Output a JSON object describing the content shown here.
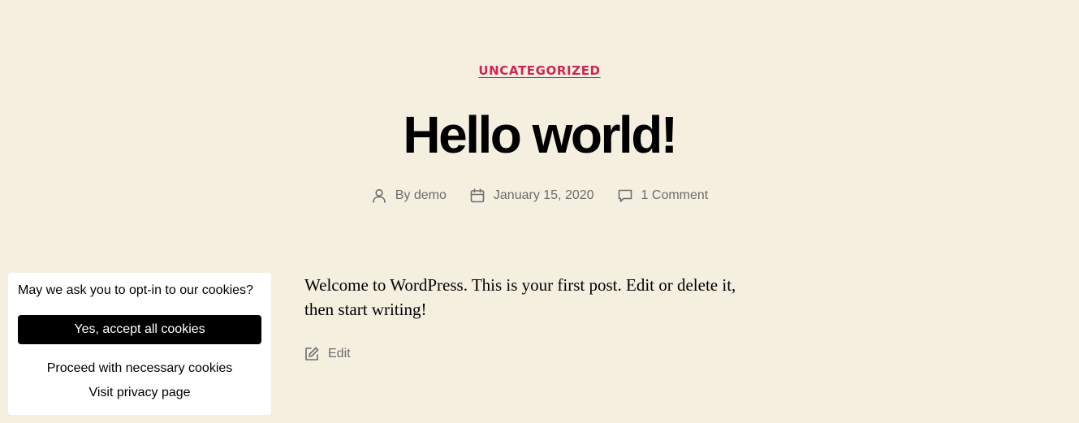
{
  "post": {
    "category": "UNCATEGORIZED",
    "title": "Hello world!",
    "meta": {
      "author_prefix": "By",
      "author": "demo",
      "date": "January 15, 2020",
      "comments": "1 Comment"
    },
    "content": "Welcome to WordPress. This is your first post. Edit or delete it, then start writing!",
    "edit_label": "Edit"
  },
  "cookie_banner": {
    "question": "May we ask you to opt-in to our cookies?",
    "accept_label": "Yes, accept all cookies",
    "necessary_label": "Proceed with necessary cookies",
    "privacy_label": "Visit privacy page"
  },
  "colors": {
    "background": "#f5efe0",
    "accent": "#cd2653",
    "meta_text": "#6d6d6d",
    "button_bg": "#000000"
  },
  "icons": {
    "author": "user-icon",
    "date": "calendar-icon",
    "comments": "comment-bubble-icon",
    "edit": "edit-pencil-icon"
  }
}
